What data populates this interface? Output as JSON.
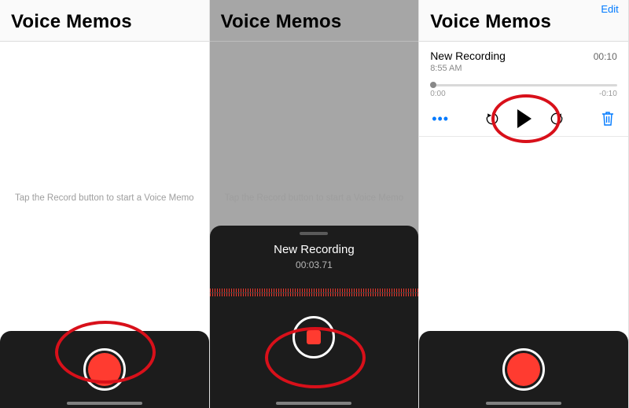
{
  "app_title": "Voice Memos",
  "hint_text": "Tap the Record button to start a Voice Memo",
  "panel2": {
    "recording_title": "New Recording",
    "elapsed": "00:03.71"
  },
  "panel3": {
    "edit_label": "Edit",
    "item_title": "New Recording",
    "item_time": "8:55 AM",
    "item_duration": "00:10",
    "scrub_start": "0:00",
    "scrub_remaining": "-0:10"
  }
}
